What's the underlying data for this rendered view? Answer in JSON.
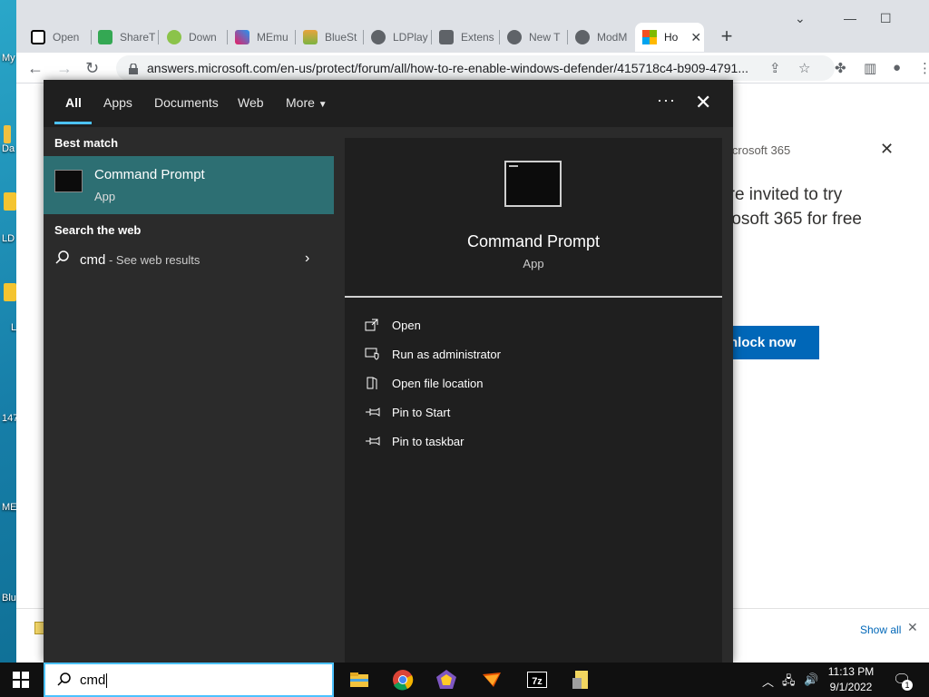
{
  "desktop": {
    "labels": [
      "My",
      "Da",
      "LD",
      "L",
      "147",
      "ME",
      "Blu"
    ]
  },
  "browser": {
    "tabs": [
      {
        "label": "Open",
        "color": "#000000"
      },
      {
        "label": "ShareT",
        "color": "#34a853"
      },
      {
        "label": "Down",
        "color": "#8bc34a"
      },
      {
        "label": "MEmu",
        "color": "#e91e63"
      },
      {
        "label": "BlueSt",
        "color": "#7cb342"
      },
      {
        "label": "LDPlay",
        "color": "#5f6368"
      },
      {
        "label": "Extens",
        "color": "#5f6368"
      },
      {
        "label": "New T",
        "color": "#5f6368"
      },
      {
        "label": "ModM",
        "color": "#5f6368"
      },
      {
        "label": "Ho",
        "color": "#f25022"
      }
    ],
    "url": "answers.microsoft.com/en-us/protect/forum/all/how-to-re-enable-windows-defender/415718c4-b909-4791..."
  },
  "page": {
    "banner_title": "icrosoft 365",
    "invite_line1": "'re invited to try",
    "invite_line2": "rosoft 365 for free",
    "unlock_label": "nlock now",
    "show_all": "Show all"
  },
  "search": {
    "tabs": [
      "All",
      "Apps",
      "Documents",
      "Web",
      "More"
    ],
    "best_match_header": "Best match",
    "best_match_title": "Command Prompt",
    "best_match_type": "App",
    "web_header": "Search the web",
    "web_query": "cmd",
    "web_suffix": " - See web results",
    "detail_title": "Command Prompt",
    "detail_type": "App",
    "actions": [
      "Open",
      "Run as administrator",
      "Open file location",
      "Pin to Start",
      "Pin to taskbar"
    ],
    "query": "cmd"
  },
  "taskbar": {
    "time": "11:13 PM",
    "date": "9/1/2022",
    "notification_count": "1"
  }
}
